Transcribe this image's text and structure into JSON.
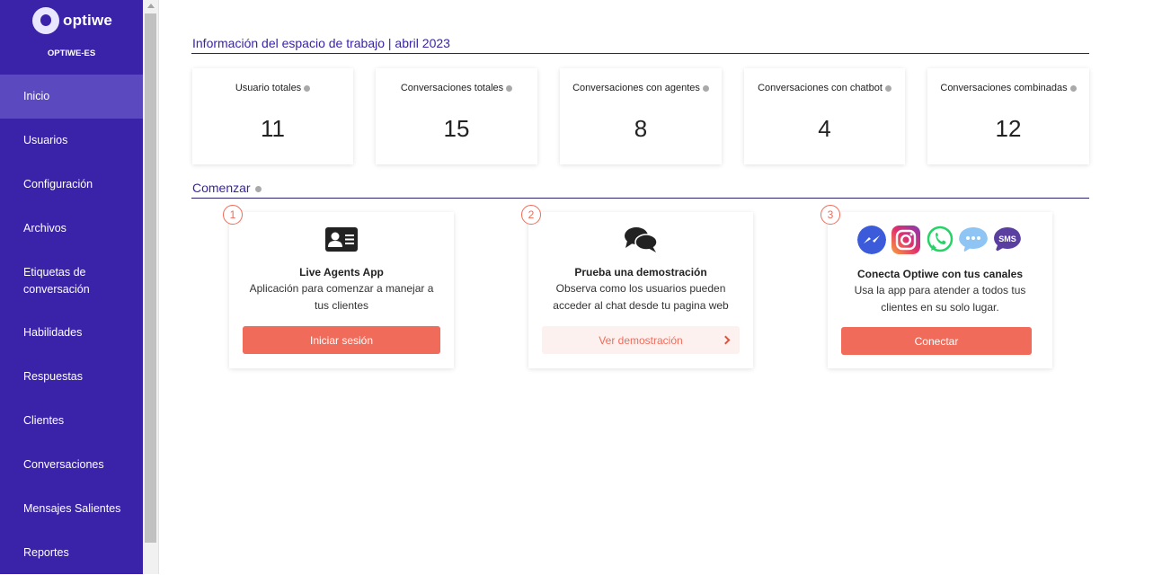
{
  "brand": {
    "name": "optiwe",
    "workspace": "OPTIWE-ES"
  },
  "sidebar": {
    "items": [
      {
        "label": "Inicio"
      },
      {
        "label": "Usuarios"
      },
      {
        "label": "Configuración"
      },
      {
        "label": "Archivos"
      },
      {
        "label": "Etiquetas de conversación"
      },
      {
        "label": "Habilidades"
      },
      {
        "label": "Respuestas"
      },
      {
        "label": "Clientes"
      },
      {
        "label": "Conversaciones"
      },
      {
        "label": "Mensajes Salientes"
      },
      {
        "label": "Reportes"
      }
    ]
  },
  "workspace_info": {
    "title": "Información del espacio de trabajo | abril 2023",
    "stats": [
      {
        "label": "Usuario totales",
        "value": "11"
      },
      {
        "label": "Conversaciones totales",
        "value": "15"
      },
      {
        "label": "Conversaciones con agentes",
        "value": "8"
      },
      {
        "label": "Conversaciones con chatbot",
        "value": "4"
      },
      {
        "label": "Conversaciones combinadas",
        "value": "12"
      }
    ]
  },
  "getting_started": {
    "title": "Comenzar",
    "cards": [
      {
        "step": "1",
        "icon": "contact-card-icon",
        "title": "Live Agents App",
        "description": "Aplicación para comenzar a manejar a tus clientes",
        "button": "Iniciar sesión"
      },
      {
        "step": "2",
        "icon": "chat-bubbles-icon",
        "title": "Prueba una demostración",
        "description": "Observa como los usuarios pueden acceder al chat desde tu pagina web",
        "button": "Ver demostración"
      },
      {
        "step": "3",
        "icons": [
          "messenger-icon",
          "instagram-icon",
          "whatsapp-icon",
          "sms-bubble-icon",
          "sms-icon"
        ],
        "sms_text": "SMS",
        "title": "Conecta Optiwe con tus canales",
        "description": "Usa la app para atender a todos tus clientes en su solo lugar.",
        "button": "Conectar"
      }
    ]
  },
  "colors": {
    "sidebar": "#3a23a8",
    "sidebar_active": "#5b4abf",
    "accent": "#f06b5a",
    "title": "#3a23a8"
  }
}
